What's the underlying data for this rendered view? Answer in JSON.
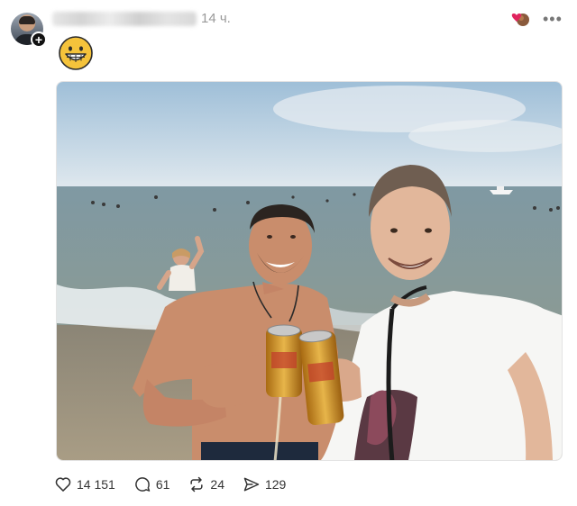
{
  "post": {
    "timestamp": "14 ч.",
    "author_avatar_icon": "user-avatar",
    "follow_badge_icon": "plus-icon",
    "follow_badge_glyph": "+",
    "reaction_icon": "heart-reaction-icon",
    "more_icon": "more-horizontal-icon",
    "more_glyph": "•••",
    "emoji": "grinning-face-emoji",
    "photo": "beach-selfie-photo"
  },
  "actions": {
    "likes": "14 151",
    "replies": "61",
    "reposts": "24",
    "shares": "129"
  },
  "colors": {
    "emoji_yellow": "#f5c33b",
    "heart_red": "#e0245e",
    "icon_gray": "#333333"
  }
}
